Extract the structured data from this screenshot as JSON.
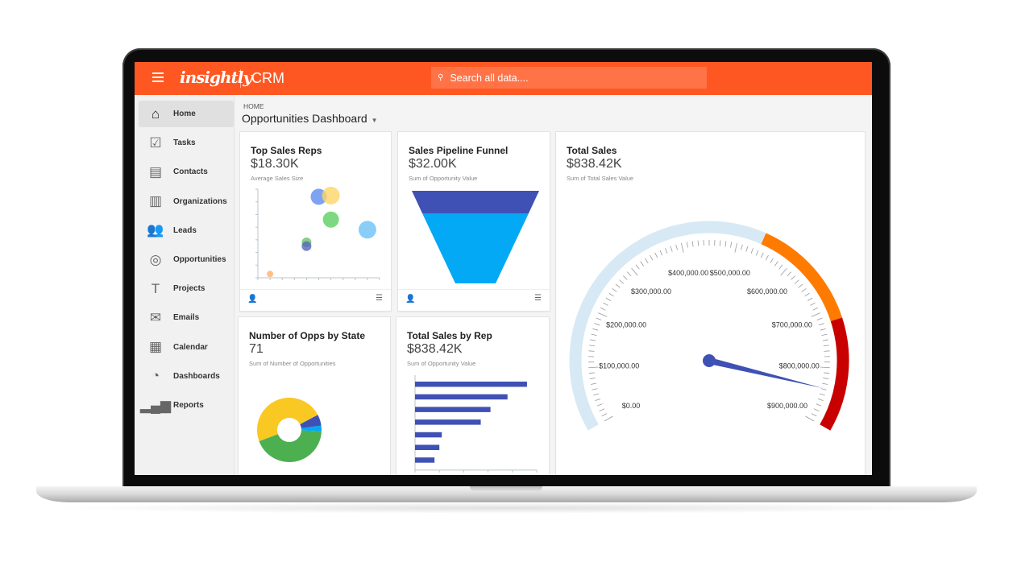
{
  "app": {
    "logo": "insightly",
    "product": "CRM",
    "accent": "#ff5722"
  },
  "search": {
    "placeholder": "Search all data....",
    "icon": "search-icon"
  },
  "sidebar": {
    "items": [
      {
        "label": "Home",
        "icon": "home-icon",
        "glyph": "⌂",
        "active": true
      },
      {
        "label": "Tasks",
        "icon": "checkbox-icon",
        "glyph": "☑"
      },
      {
        "label": "Contacts",
        "icon": "contact-card-icon",
        "glyph": "▤"
      },
      {
        "label": "Organizations",
        "icon": "building-icon",
        "glyph": "▥"
      },
      {
        "label": "Leads",
        "icon": "people-icon",
        "glyph": "👥"
      },
      {
        "label": "Opportunities",
        "icon": "target-icon",
        "glyph": "◎"
      },
      {
        "label": "Projects",
        "icon": "hammer-icon",
        "glyph": "T"
      },
      {
        "label": "Emails",
        "icon": "envelope-icon",
        "glyph": "✉"
      },
      {
        "label": "Calendar",
        "icon": "calendar-icon",
        "glyph": "▦"
      },
      {
        "label": "Dashboards",
        "icon": "speedometer-icon",
        "glyph": "◔"
      },
      {
        "label": "Reports",
        "icon": "bar-chart-icon",
        "glyph": "▂▄▆"
      }
    ]
  },
  "breadcrumb": "HOME",
  "page_title": "Opportunities Dashboard",
  "cards": {
    "top_sales_reps": {
      "title": "Top Sales Reps",
      "value": "$18.30K",
      "subtitle": "Average Sales Size"
    },
    "pipeline_funnel": {
      "title": "Sales Pipeline Funnel",
      "value": "$32.00K",
      "subtitle": "Sum of Opportunity Value"
    },
    "total_sales": {
      "title": "Total Sales",
      "value": "$838.42K",
      "subtitle": "Sum of Total Sales Value"
    },
    "opps_by_state": {
      "title": "Number of Opps by State",
      "value": "71",
      "subtitle": "Sum of Number of Opportunities"
    },
    "sales_by_rep": {
      "title": "Total Sales by Rep",
      "value": "$838.42K",
      "subtitle": "Sum of Opportunity Value"
    }
  },
  "chart_data": [
    {
      "type": "scatter",
      "subtype": "bubble",
      "xlim": [
        0,
        10
      ],
      "ylim": [
        0,
        7
      ],
      "grid": false,
      "points": [
        {
          "x": 5,
          "y": 6.4,
          "size": 10,
          "color": "#5b8def"
        },
        {
          "x": 6,
          "y": 6.5,
          "size": 11,
          "color": "#fcd667"
        },
        {
          "x": 6,
          "y": 4.6,
          "size": 10,
          "color": "#5cd062"
        },
        {
          "x": 9,
          "y": 3.8,
          "size": 11,
          "color": "#6ec1f7"
        },
        {
          "x": 4,
          "y": 2.8,
          "size": 6,
          "color": "#6cc26b"
        },
        {
          "x": 4,
          "y": 2.5,
          "size": 6,
          "color": "#5966b8"
        },
        {
          "x": 1,
          "y": 0.3,
          "size": 4,
          "color": "#fbb366"
        }
      ]
    },
    {
      "type": "funnel",
      "stages": [
        {
          "color": "#3f51b5"
        },
        {
          "color": "#03a9f4"
        }
      ]
    },
    {
      "type": "gauge",
      "min": 0,
      "max": 900000,
      "value": 838420,
      "tick_labels": [
        "$0.00",
        "$100,000.00",
        "$200,000.00",
        "$300,000.00",
        "$400,000.00",
        "$500,000.00",
        "$600,000.00",
        "$700,000.00",
        "$800,000.00",
        "$900,000.00"
      ],
      "bands": [
        {
          "from": 0,
          "to": 540000,
          "color": "#d7e9f5"
        },
        {
          "from": 540000,
          "to": 720000,
          "color": "#ff7b00"
        },
        {
          "from": 720000,
          "to": 900000,
          "color": "#c80000"
        }
      ],
      "needle_color": "#3f51b5"
    },
    {
      "type": "pie",
      "donut": true,
      "total": 71,
      "slices": [
        {
          "value": 4,
          "color": "#3f51b5"
        },
        {
          "value": 2,
          "color": "#03a9f4"
        },
        {
          "value": 31,
          "color": "#4caf50"
        },
        {
          "value": 34,
          "color": "#f9c823"
        }
      ]
    },
    {
      "type": "bar",
      "orientation": "horizontal",
      "xlim": [
        0,
        250000
      ],
      "color": "#3f51b5",
      "values": [
        230000,
        190000,
        155000,
        135000,
        55000,
        50000,
        40000
      ]
    }
  ]
}
